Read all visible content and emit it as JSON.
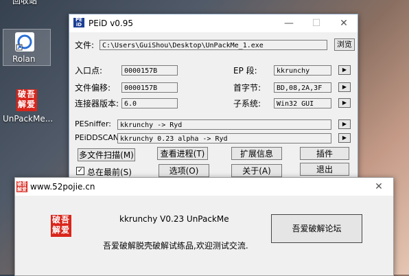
{
  "desktop": {
    "top_label": "回收站",
    "icon1_label": "Rolan",
    "icon2_label": "UnPackMe...",
    "seal_chars": "破吾解爱"
  },
  "peid": {
    "title": "PEiD v0.95",
    "file_label": "文件:",
    "file_path": "C:\\Users\\GuiShou\\Desktop\\UnPackMe_1.exe",
    "browse_btn": "浏览",
    "entry_label": "入口点:",
    "entry_value": "0000157B",
    "ep_section_label": "EP 段:",
    "ep_section_value": "kkrunchy",
    "offset_label": "文件偏移:",
    "offset_value": "0000157B",
    "first_bytes_label": "首字节:",
    "first_bytes_value": "BD,08,2A,3F",
    "linker_label": "连接器版本:",
    "linker_value": "6.0",
    "subsystem_label": "子系统:",
    "subsystem_value": "Win32 GUI",
    "pesniffer_label": "PESniffer:",
    "pesniffer_value": "kkrunchy -> Ryd",
    "peiddscan_label": "PEiDDSCAN:",
    "peiddscan_value": "kkrunchy 0.23 alpha -> Ryd",
    "multi_scan_btn": "多文件扫描(M)",
    "view_process_btn": "查看进程(T)",
    "extend_info_btn": "扩展信息",
    "plugins_btn": "插件",
    "always_top_label": "总在最前(S)",
    "options_btn": "选项(O)",
    "about_btn": "关于(A)",
    "exit_btn": "退出"
  },
  "dialog": {
    "title": "www.52pojie.cn",
    "heading": "kkrunchy V0.23  UnPackMe",
    "message": "吾爱破解脱壳破解试练品,欢迎测试交流.",
    "link_btn": "吾爱破解论坛",
    "seal_chars": "破吾解爱"
  }
}
